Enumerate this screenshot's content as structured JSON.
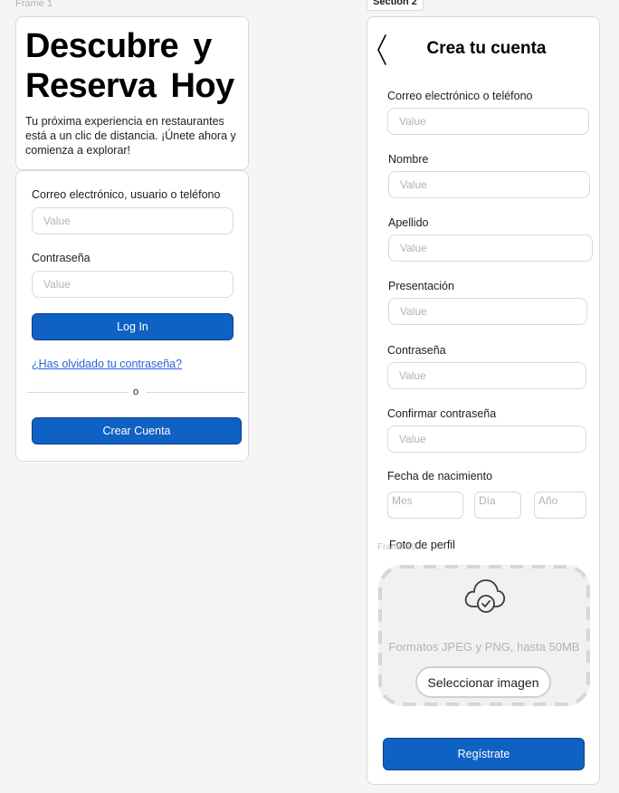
{
  "canvas": {
    "frame1_label": "Frame 1",
    "section2_label": "Section 2",
    "frame19_label": "Frame 19"
  },
  "hero": {
    "title": "Descubre y Reserva Hoy",
    "subtitle": "Tu próxima experiencia en restaurantes está a un clic de distancia. ¡Únete ahora y comienza a explorar!"
  },
  "login": {
    "user_label": "Correo electrónico, usuario o teléfono",
    "user_placeholder": "Value",
    "password_label": "Contraseña",
    "password_placeholder": "Value",
    "login_button": "Log In",
    "forgot_link": "¿Has olvidado tu contraseña?",
    "divider_text": "o",
    "create_button": "Crear Cuenta"
  },
  "signup": {
    "title": "Crea tu cuenta",
    "fields": [
      {
        "label": "Correo electrónico o teléfono",
        "placeholder": "Value"
      },
      {
        "label": "Nombre",
        "placeholder": "Value"
      },
      {
        "label": "Apellido",
        "placeholder": "Value"
      },
      {
        "label": "Presentación",
        "placeholder": "Value"
      },
      {
        "label": "Contraseña",
        "placeholder": "Value"
      },
      {
        "label": "Confirmar contraseña",
        "placeholder": "Value"
      }
    ],
    "birthdate_label": "Fecha de nacimiento",
    "birth_month_placeholder": "Mes",
    "birth_day_placeholder": "Día",
    "birth_year_placeholder": "Año",
    "photo_label": "Foto de perfil",
    "upload_hint": "Formatos JPEG y PNG, hasta 50MB",
    "upload_button": "Seleccionar imagen",
    "register_button": "Regístrate"
  },
  "icons": {
    "back": "chevron-left-icon",
    "upload": "cloud-check-icon"
  },
  "colors": {
    "primary": "#1061c4",
    "link": "#2b63d9",
    "border": "#d9d9d9",
    "placeholder": "#b3b3b3"
  }
}
